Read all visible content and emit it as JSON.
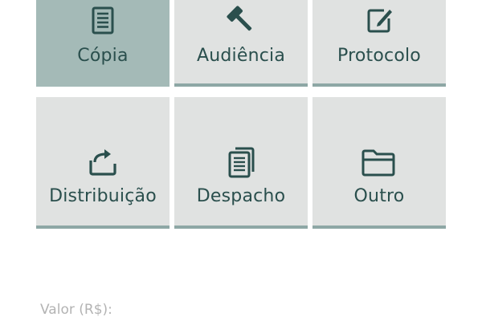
{
  "tiles": [
    {
      "label": "Cópia",
      "icon": "document-icon",
      "selected": true
    },
    {
      "label": "Audiência",
      "icon": "gavel-icon",
      "selected": false
    },
    {
      "label": "Protocolo",
      "icon": "edit-icon",
      "selected": false
    },
    {
      "label": "Distribuição",
      "icon": "share-tray-icon",
      "selected": false
    },
    {
      "label": "Despacho",
      "icon": "documents-icon",
      "selected": false
    },
    {
      "label": "Outro",
      "icon": "folder-icon",
      "selected": false
    }
  ],
  "form": {
    "valor_label": "Valor (R$):"
  },
  "colors": {
    "tile_bg": "#e0e2e1",
    "tile_selected_bg": "#a4bab7",
    "tile_underline": "#8ea7a5",
    "icon_and_text": "#2a4f4d",
    "field_label": "#b3b3b3"
  }
}
